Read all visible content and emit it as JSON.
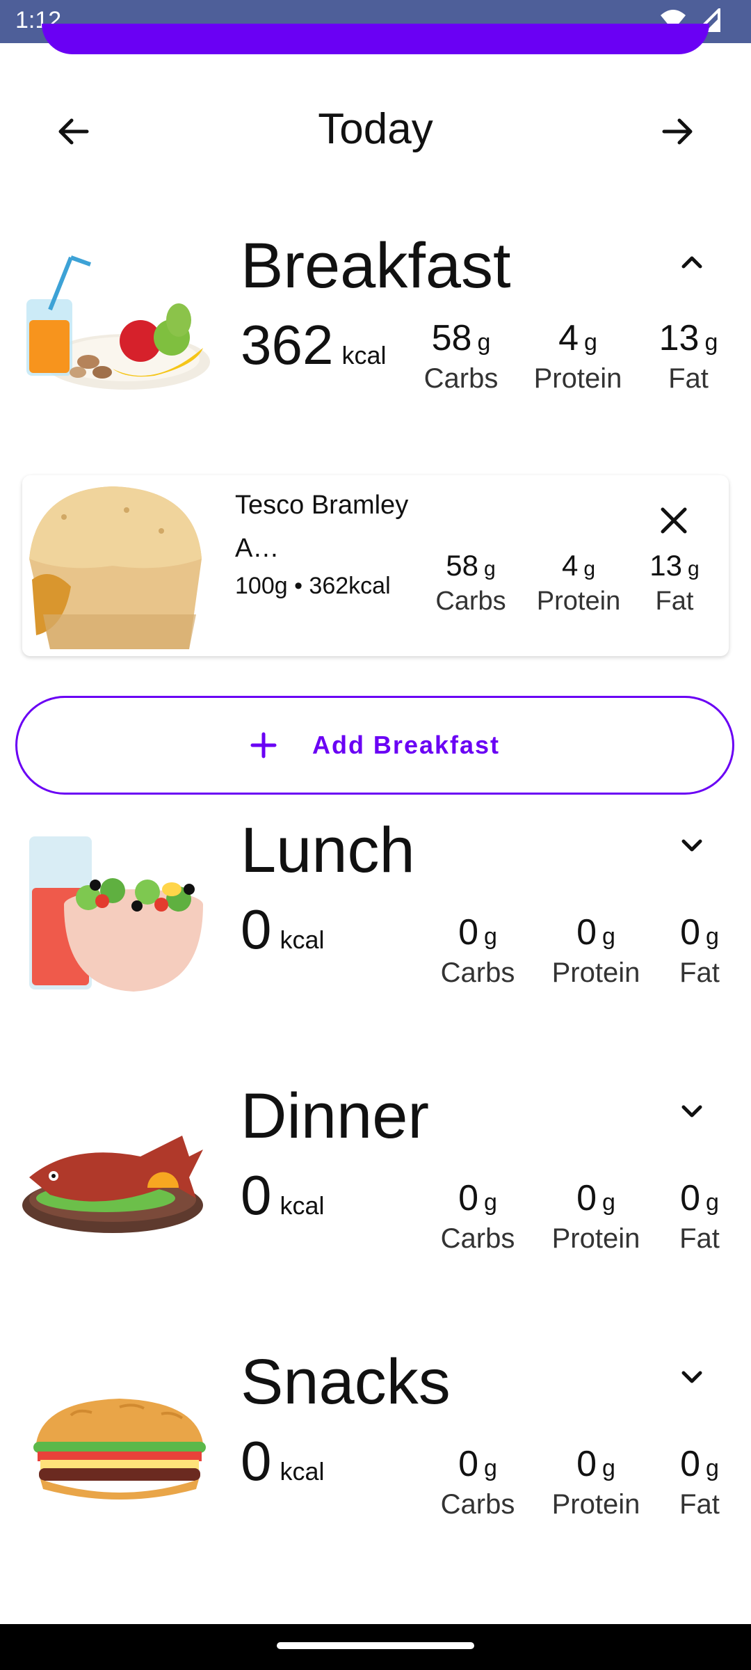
{
  "status": {
    "time": "1:12"
  },
  "header": {
    "title": "Today"
  },
  "meals": {
    "breakfast": {
      "name": "Breakfast",
      "kcal": "362",
      "kcal_unit": "kcal",
      "carbs": "58",
      "protein": "4",
      "fat": "13",
      "unit": "g",
      "carbs_label": "Carbs",
      "protein_label": "Protein",
      "fat_label": "Fat"
    },
    "lunch": {
      "name": "Lunch",
      "kcal": "0",
      "kcal_unit": "kcal",
      "carbs": "0",
      "protein": "0",
      "fat": "0",
      "unit": "g",
      "carbs_label": "Carbs",
      "protein_label": "Protein",
      "fat_label": "Fat"
    },
    "dinner": {
      "name": "Dinner",
      "kcal": "0",
      "kcal_unit": "kcal",
      "carbs": "0",
      "protein": "0",
      "fat": "0",
      "unit": "g",
      "carbs_label": "Carbs",
      "protein_label": "Protein",
      "fat_label": "Fat"
    },
    "snacks": {
      "name": "Snacks",
      "kcal": "0",
      "kcal_unit": "kcal",
      "carbs": "0",
      "protein": "0",
      "fat": "0",
      "unit": "g",
      "carbs_label": "Carbs",
      "protein_label": "Protein",
      "fat_label": "Fat"
    }
  },
  "food_item": {
    "name": "Tesco Bramley A…",
    "meta": "100g • 362kcal",
    "carbs": "58",
    "protein": "4",
    "fat": "13",
    "unit": "g",
    "carbs_label": "Carbs",
    "protein_label": "Protein",
    "fat_label": "Fat"
  },
  "add_button": {
    "label": "Add Breakfast"
  },
  "colors": {
    "accent": "#6a00f4",
    "status_bar": "#4e5f99"
  },
  "icons": {
    "prev": "arrow-left-icon",
    "next": "arrow-right-icon",
    "collapse": "chevron-up-icon",
    "expand": "chevron-down-icon",
    "remove": "close-icon",
    "add": "plus-icon"
  }
}
